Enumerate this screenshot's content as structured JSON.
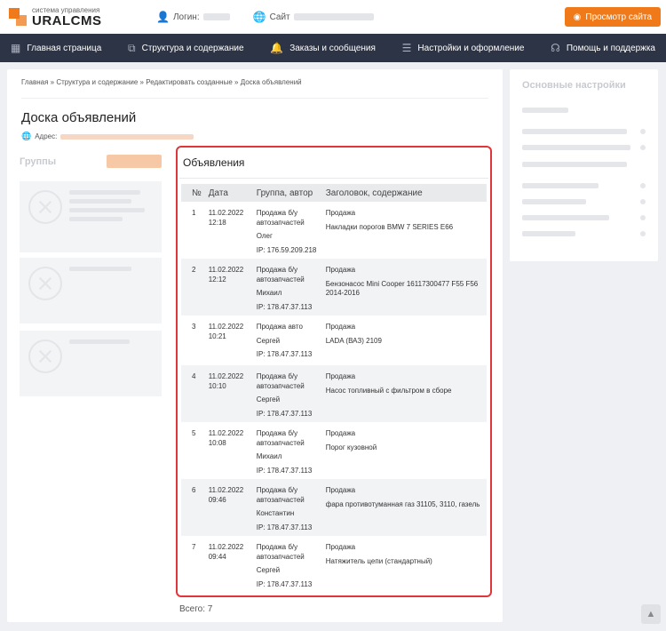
{
  "header": {
    "logo_sub": "система управления",
    "logo_main": "URALCMS",
    "login_label": "Логин:",
    "site_label": "Сайт",
    "view_button": "Просмотр сайта"
  },
  "nav": [
    {
      "label": "Главная страница",
      "icon": "grid-icon"
    },
    {
      "label": "Структура и содержание",
      "icon": "sitemap-icon"
    },
    {
      "label": "Заказы и сообщения",
      "icon": "bell-icon"
    },
    {
      "label": "Настройки и оформление",
      "icon": "sliders-icon"
    },
    {
      "label": "Помощь и поддержка",
      "icon": "headset-icon"
    }
  ],
  "breadcrumb": {
    "items": [
      "Главная",
      "Структура и содержание",
      "Редактировать созданные"
    ],
    "current": "Доска объявлений"
  },
  "page": {
    "title": "Доска объявлений",
    "address_label": "Адрес:",
    "groups_title": "Группы"
  },
  "sidebar": {
    "title": "Основные настройки"
  },
  "board": {
    "title": "Объявления",
    "columns": [
      "№",
      "Дата",
      "Группа, автор",
      "Заголовок, содержание"
    ],
    "rows": [
      {
        "n": "1",
        "date": "11.02.2022",
        "time": "12:18",
        "group": "Продажа б/у автозапчастей",
        "author": "Олег",
        "ip": "IP: 176.59.209.218",
        "type": "Продажа",
        "text": "Накладки порогов BMW 7 SERIES E66"
      },
      {
        "n": "2",
        "date": "11.02.2022",
        "time": "12:12",
        "group": "Продажа б/у автозапчастей",
        "author": "Михаил",
        "ip": "IP: 178.47.37.113",
        "type": "Продажа",
        "text": "Бензонасос Mini Cooper 16117300477 F55 F56 2014-2016"
      },
      {
        "n": "3",
        "date": "11.02.2022",
        "time": "10:21",
        "group": "Продажа авто",
        "author": "Сергей",
        "ip": "IP: 178.47.37.113",
        "type": "Продажа",
        "text": "LADA (ВАЗ) 2109"
      },
      {
        "n": "4",
        "date": "11.02.2022",
        "time": "10:10",
        "group": "Продажа б/у автозапчастей",
        "author": "Сергей",
        "ip": "IP: 178.47.37.113",
        "type": "Продажа",
        "text": "Насос топливный с фильтром в сборе"
      },
      {
        "n": "5",
        "date": "11.02.2022",
        "time": "10:08",
        "group": "Продажа б/у автозапчастей",
        "author": "Михаил",
        "ip": "IP: 178.47.37.113",
        "type": "Продажа",
        "text": "Порог кузовной"
      },
      {
        "n": "6",
        "date": "11.02.2022",
        "time": "09:46",
        "group": "Продажа б/у автозапчастей",
        "author": "Константин",
        "ip": "IP: 178.47.37.113",
        "type": "Продажа",
        "text": "фара противотуманная газ 31105, 3110, газель"
      },
      {
        "n": "7",
        "date": "11.02.2022",
        "time": "09:44",
        "group": "Продажа б/у автозапчастей",
        "author": "Сергей",
        "ip": "IP: 178.47.37.113",
        "type": "Продажа",
        "text": "Натяжитель цепи (стандартный)"
      }
    ],
    "total": "Всего: 7"
  }
}
